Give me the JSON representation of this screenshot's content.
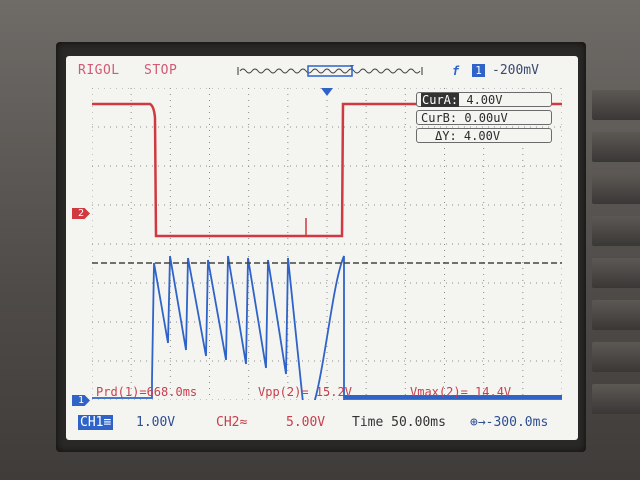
{
  "header": {
    "brand": "RIGOL",
    "run_state": "STOP",
    "trigger_slope": "f",
    "trigger_source": "1",
    "trigger_level": "-200mV"
  },
  "cursors": {
    "cur_a_label": "CurA:",
    "cur_a_value": "4.00V",
    "cur_b_label": "CurB:",
    "cur_b_value": "0.00uV",
    "delta_label": "ΔY:",
    "delta_value": "4.00V"
  },
  "markers": {
    "ch2_ground": "2",
    "ch1_ground": "1"
  },
  "measurements": {
    "period": "Prd(1)=668.0ms",
    "vpp": "Vpp(2)= 15.2V",
    "vmax": "Vmax(2)= 14.4V"
  },
  "footer": {
    "ch1_tag": "CH1≡",
    "ch1_scale": "1.00V",
    "ch2_tag": "CH2≈",
    "ch2_scale": "5.00V",
    "timebase": "Time 50.00ms",
    "offset": "⊕→-300.0ms"
  },
  "colors": {
    "ch1": "#2f63c8",
    "ch2": "#d0393f",
    "grid": "#8c8c8c",
    "screen": "#f4f4f1"
  },
  "icons": {
    "trigger_slope": "rising-edge-icon",
    "trigger_pointer": "trigger-position-icon",
    "ch2_marker": "ch2-ground-marker-icon",
    "ch1_marker": "ch1-ground-marker-icon"
  }
}
